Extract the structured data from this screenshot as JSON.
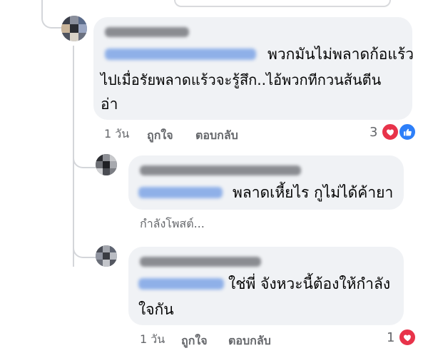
{
  "comments": [
    {
      "text_lines": [
        "พวกมันไม่พลาดก้อแร้ว",
        "ไปเมื่อรัยพลาดแร้วจะรู้สึก..ไอ้พวกทีกวนส้นตีน",
        "อ่า"
      ],
      "time": "1 วัน",
      "like_label": "ถูกใจ",
      "reply_label": "ตอบกลับ",
      "reactions": {
        "count": "3",
        "icons": [
          "heart-icon",
          "like-icon"
        ]
      }
    },
    {
      "text_lines": [
        "พลาดเหี้ยไร กูไม่ได้ค้ายา"
      ],
      "status": "กำลังโพสต์..."
    },
    {
      "text_lines": [
        "ใช่พี่ จังหวะนี้ต้องให้กำลัง",
        "ใจกัน"
      ],
      "time": "1 วัน",
      "like_label": "ถูกใจ",
      "reply_label": "ตอบกลับ",
      "reactions": {
        "count": "1",
        "icons": [
          "heart-icon"
        ]
      }
    }
  ],
  "colors": {
    "bubble": "#f0f2f5",
    "meta": "#65676b",
    "heart": "#e8334a",
    "like": "#2d7ff9",
    "mention": "#385898"
  }
}
